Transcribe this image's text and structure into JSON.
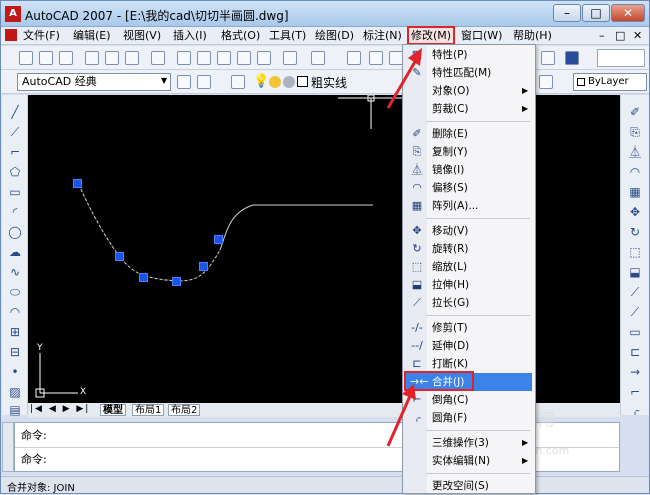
{
  "window": {
    "title": "AutoCAD 2007 - [E:\\我的cad\\切切半画圆.dwg]",
    "app_icon": "A"
  },
  "window_controls": {
    "minimize": "–",
    "maximize": "□",
    "close": "✕"
  },
  "menubar": [
    {
      "label": "文件(F)"
    },
    {
      "label": "编辑(E)"
    },
    {
      "label": "视图(V)"
    },
    {
      "label": "插入(I)"
    },
    {
      "label": "格式(O)"
    },
    {
      "label": "工具(T)"
    },
    {
      "label": "绘图(D)"
    },
    {
      "label": "标注(N)"
    },
    {
      "label": "修改(M)"
    },
    {
      "label": "窗口(W)"
    },
    {
      "label": "帮助(H)"
    }
  ],
  "toolbar2": {
    "workspace": "AutoCAD 经典",
    "linetype": "粗实线",
    "layer_color": "ByLayer"
  },
  "dropdown": {
    "items": [
      {
        "icon": "properties-icon",
        "glyph": "▦",
        "label": "特性(P)"
      },
      {
        "icon": "match-icon",
        "glyph": "✎",
        "label": "特性匹配(M)"
      },
      {
        "icon": "",
        "glyph": "",
        "label": "对象(O)",
        "submenu": true
      },
      {
        "icon": "",
        "glyph": "",
        "label": "剪裁(C)",
        "submenu": true
      },
      {
        "sep": true
      },
      {
        "icon": "erase-icon",
        "glyph": "✐",
        "label": "删除(E)"
      },
      {
        "icon": "copy-icon",
        "glyph": "⎘",
        "label": "复制(Y)"
      },
      {
        "icon": "mirror-icon",
        "glyph": "⏅",
        "label": "镜像(I)"
      },
      {
        "icon": "offset-icon",
        "glyph": "◠",
        "label": "偏移(S)"
      },
      {
        "icon": "array-icon",
        "glyph": "▦",
        "label": "阵列(A)..."
      },
      {
        "sep": true
      },
      {
        "icon": "move-icon",
        "glyph": "✥",
        "label": "移动(V)"
      },
      {
        "icon": "rotate-icon",
        "glyph": "↻",
        "label": "旋转(R)"
      },
      {
        "icon": "scale-icon",
        "glyph": "⬚",
        "label": "缩放(L)"
      },
      {
        "icon": "stretch-icon",
        "glyph": "⬓",
        "label": "拉伸(H)"
      },
      {
        "icon": "lengthen-icon",
        "glyph": "⟋",
        "label": "拉长(G)"
      },
      {
        "sep": true
      },
      {
        "icon": "trim-icon",
        "glyph": "-/-",
        "label": "修剪(T)"
      },
      {
        "icon": "extend-icon",
        "glyph": "--/",
        "label": "延伸(D)"
      },
      {
        "icon": "break-icon",
        "glyph": "⊏",
        "label": "打断(K)"
      },
      {
        "icon": "join-icon",
        "glyph": "→←",
        "label": "合并(J)",
        "highlight": true
      },
      {
        "icon": "chamfer-icon",
        "glyph": "⌐",
        "label": "倒角(C)"
      },
      {
        "icon": "fillet-icon",
        "glyph": "⌌",
        "label": "圆角(F)"
      },
      {
        "sep": true
      },
      {
        "icon": "",
        "glyph": "",
        "label": "三维操作(3)",
        "submenu": true
      },
      {
        "icon": "",
        "glyph": "",
        "label": "实体编辑(N)",
        "submenu": true
      },
      {
        "sep": true
      },
      {
        "icon": "",
        "glyph": "",
        "label": "更改空间(S)"
      }
    ]
  },
  "tabs": [
    "模型",
    "布局1",
    "布局2"
  ],
  "command": {
    "line1": "命令:",
    "line2": "命令:"
  },
  "status": {
    "text": "合并对象:  JOIN"
  },
  "ucs": {
    "x": "X",
    "y": "Y"
  },
  "watermark": {
    "main": "@拍游指南",
    "sub": "shipinlzhinan.com"
  },
  "colors": {
    "accent": "#e0242a",
    "highlight": "#3b83e8",
    "grip": "#1a54e6",
    "canvas": "#000000"
  }
}
